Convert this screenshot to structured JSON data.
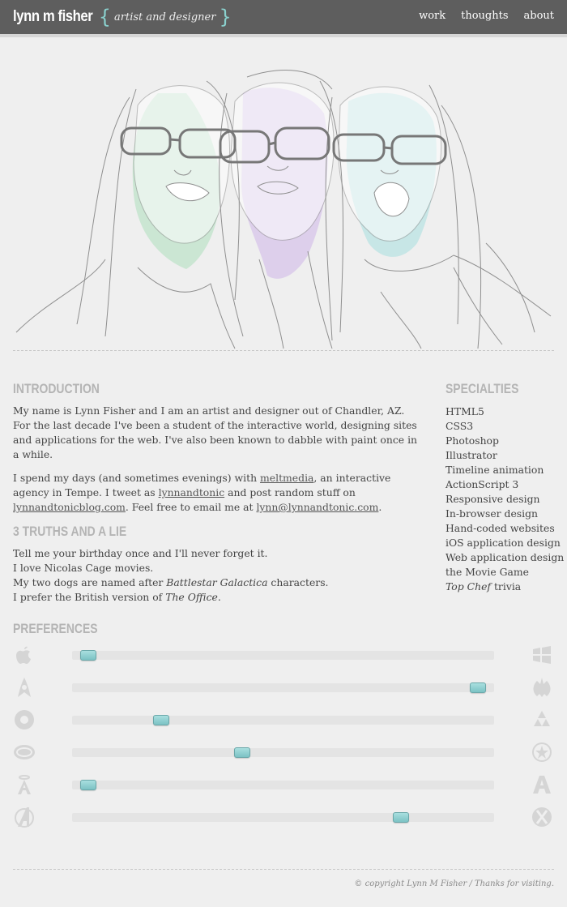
{
  "header": {
    "site_name": "lynn m fisher",
    "brace_open": "{",
    "tagline": "artist and designer",
    "brace_close": "}",
    "nav": [
      {
        "label": "work"
      },
      {
        "label": "thoughts"
      },
      {
        "label": "about"
      }
    ]
  },
  "intro": {
    "title": "INTRODUCTION",
    "p1": "My name is Lynn Fisher and I am an artist and designer out of Chandler, AZ. For the last decade I've been a student of the interactive world, designing sites and applications for the web. I've also been known to dabble with paint once in a while.",
    "p2_a": "I spend my days (and sometimes evenings) with ",
    "p2_link1": "meltmedia",
    "p2_b": ", an interactive agency in Tempe. I tweet as ",
    "p2_link2": "lynnandtonic",
    "p2_c": " and post random stuff on ",
    "p2_link3": "lynnandtonicblog.com",
    "p2_d": ". Feel free to email me at ",
    "p2_link4": "lynn@lynnandtonic.com",
    "p2_e": "."
  },
  "truths": {
    "title": "3 TRUTHS AND A LIE",
    "line1": "Tell me your birthday once and I'll never forget it.",
    "line2": "I love Nicolas Cage movies.",
    "line3_a": "My two dogs are named after ",
    "line3_em": "Battlestar Galactica",
    "line3_b": " characters.",
    "line4_a": "I prefer the British version of ",
    "line4_em": "The Office",
    "line4_b": "."
  },
  "specialties": {
    "title": "SPECIALTIES",
    "items": [
      "HTML5",
      "CSS3",
      "Photoshop",
      "Illustrator",
      "Timeline animation",
      "ActionScript 3",
      "Responsive design",
      "In-browser design",
      "Hand-coded websites",
      "iOS application design",
      "Web application design",
      "the Movie Game"
    ],
    "last_em": "Top Chef",
    "last_rest": " trivia"
  },
  "preferences": {
    "title": "PREFERENCES",
    "rows": [
      {
        "left_icon": "apple-icon",
        "right_icon": "windows-icon",
        "value": 0.02
      },
      {
        "left_icon": "starfleet-icon",
        "right_icon": "rebel-alliance-icon",
        "value": 0.98
      },
      {
        "left_icon": "lifesaver-candy-icon",
        "right_icon": "triforce-icon",
        "value": 0.2
      },
      {
        "left_icon": "vote-badge-icon",
        "right_icon": "star-badge-icon",
        "value": 0.4
      },
      {
        "left_icon": "angels-logo-icon",
        "right_icon": "athletics-logo-icon",
        "value": 0.02
      },
      {
        "left_icon": "avengers-logo-icon",
        "right_icon": "xbox-logo-icon",
        "value": 0.79
      }
    ]
  },
  "footer": {
    "text": "© copyright Lynn M Fisher / Thanks for visiting."
  },
  "colors": {
    "accent_teal": "#8ad1ce",
    "header_bg": "#5e5e5e",
    "heading_gray": "#b4b4b4"
  }
}
